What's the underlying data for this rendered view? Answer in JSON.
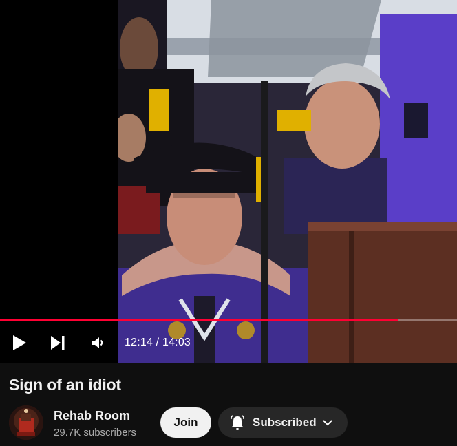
{
  "player": {
    "current_time": "12:14",
    "duration": "14:03",
    "time_display": "12:14 / 14:03",
    "progress_fraction": 0.872,
    "icons": [
      "play-icon",
      "next-icon",
      "volume-icon"
    ],
    "colors": {
      "progress": "#ff0033"
    }
  },
  "video": {
    "title": "Sign of an idiot"
  },
  "channel": {
    "name": "Rehab Room",
    "subscribers": "29.7K subscribers",
    "avatar_icon": "channel-avatar"
  },
  "actions": {
    "join_label": "Join",
    "subscribed_label": "Subscribed",
    "icons": [
      "bell-icon",
      "chevron-down-icon"
    ]
  }
}
